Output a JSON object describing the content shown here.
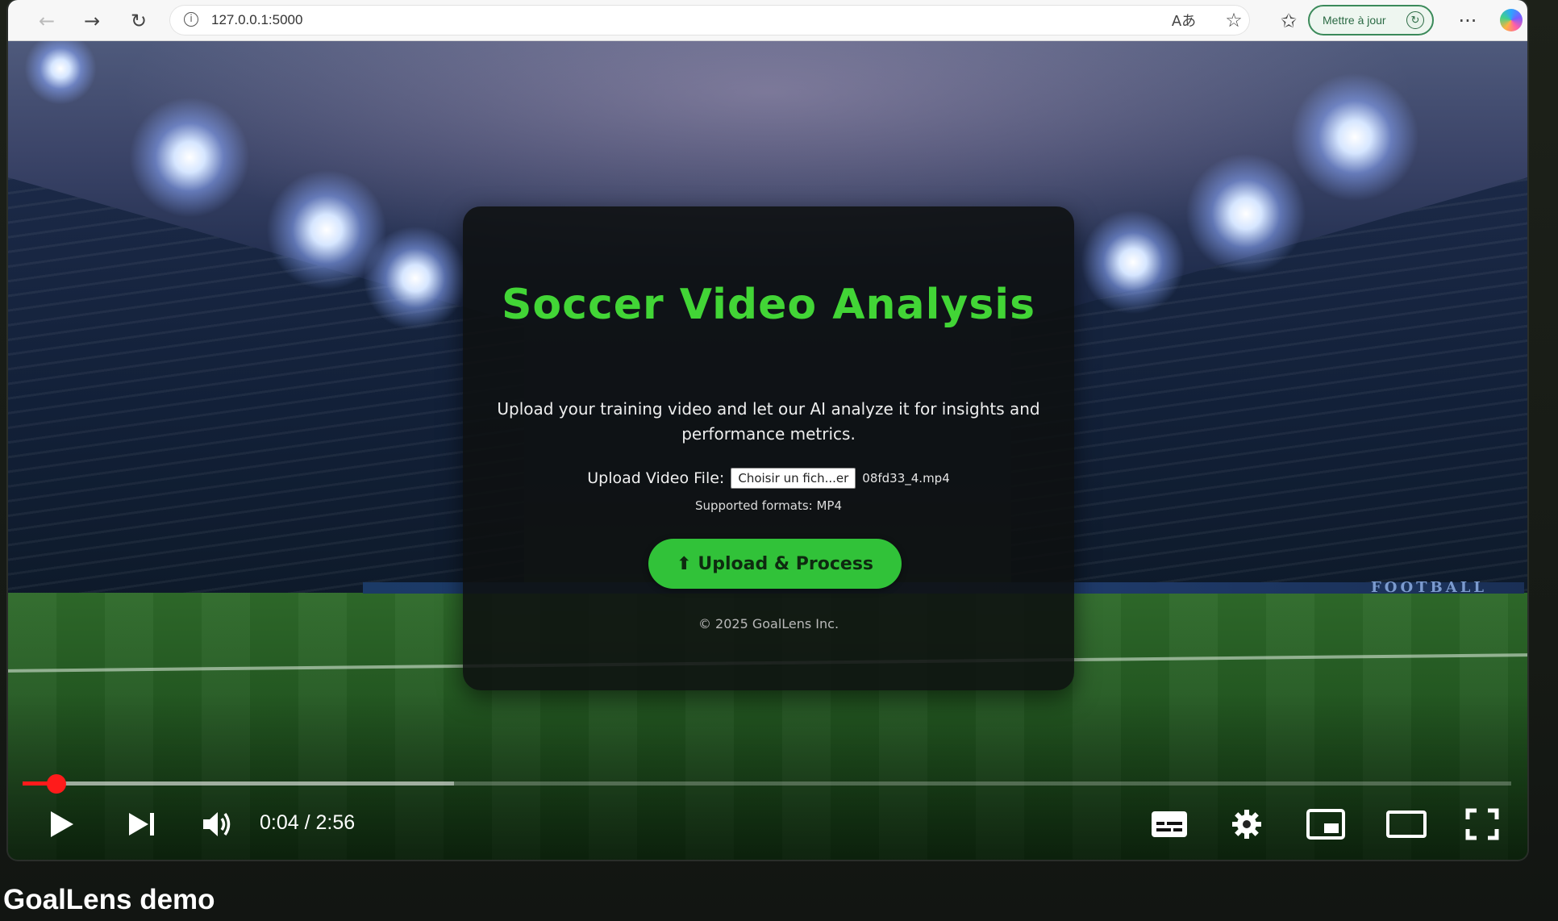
{
  "browser": {
    "url": "127.0.0.1:5000",
    "update_button_label": "Mettre à jour",
    "icons": [
      "back-icon",
      "forward-icon",
      "reload-icon",
      "info-icon",
      "read-aloud-icon",
      "favorite-star-icon",
      "favorites-icon",
      "more-icon",
      "copilot-icon"
    ]
  },
  "app": {
    "title": "Soccer Video Analysis",
    "description": "Upload your training video and let our AI analyze it for insights and performance metrics.",
    "file_label": "Upload Video File:",
    "file_button_text": "Choisir un fich...er",
    "file_name": "08fd33_4.mp4",
    "formats": "Supported formats: MP4",
    "upload_button": "Upload & Process",
    "copyright": "© 2025 GoalLens Inc.",
    "accent_color": "#42d536"
  },
  "background": {
    "banner_text": "FOOTBALL"
  },
  "player": {
    "current_time": "0:04",
    "duration": "2:56",
    "time_display": "0:04 / 2:56",
    "played_fraction": 0.023,
    "buffered_fraction": 0.29,
    "progress_color": "#ff1b1b"
  },
  "video": {
    "title": "GoalLens demo"
  }
}
